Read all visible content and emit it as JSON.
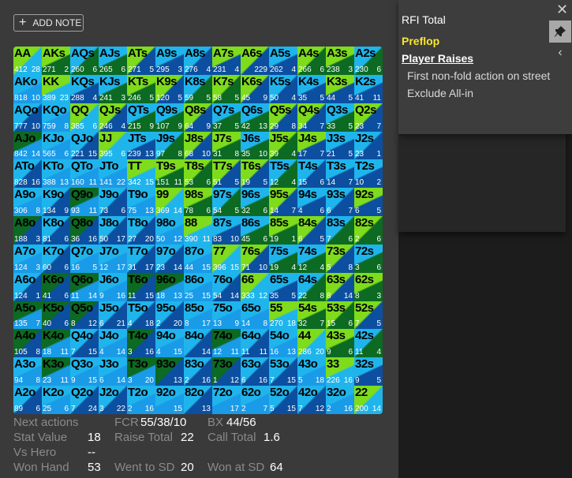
{
  "toolbar": {
    "add_note_label": "ADD NOTE"
  },
  "panel": {
    "title": "RFI Total",
    "preflop": "Preflop",
    "player_raises": "Player Raises",
    "option1": "First non-fold action on street",
    "option2": "Exclude All-in"
  },
  "colors": {
    "lime": "#7edc1c",
    "blue": "#1a9be8",
    "dark_green": "#0c6a22",
    "dark_blue": "#0c4fa0",
    "sky": "#1fb5ec"
  },
  "grid": [
    [
      [
        "AA",
        "412",
        "28"
      ],
      [
        "AKs",
        "271",
        "2"
      ],
      [
        "AQs",
        "260",
        "6"
      ],
      [
        "AJs",
        "265",
        "6"
      ],
      [
        "ATs",
        "271",
        "5"
      ],
      [
        "A9s",
        "295",
        "3"
      ],
      [
        "A8s",
        "276",
        "4"
      ],
      [
        "A7s",
        "231",
        "4"
      ],
      [
        "A6s",
        "",
        "229"
      ],
      [
        "A5s",
        "262",
        "4"
      ],
      [
        "A4s",
        "266",
        "6"
      ],
      [
        "A3s",
        "238",
        "3"
      ],
      [
        "A2s",
        "230",
        "6"
      ]
    ],
    [
      [
        "AKo",
        "818",
        "10"
      ],
      [
        "KK",
        "389",
        "23"
      ],
      [
        "KQs",
        "288",
        "4"
      ],
      [
        "KJs",
        "241",
        "3"
      ],
      [
        "KTs",
        "246",
        "5"
      ],
      [
        "K9s",
        "120",
        "5"
      ],
      [
        "K8s",
        "59",
        "5"
      ],
      [
        "K7s",
        "58",
        "5"
      ],
      [
        "K6s",
        "45",
        "9"
      ],
      [
        "K5s",
        "50",
        "4"
      ],
      [
        "K4s",
        "35",
        "5"
      ],
      [
        "K3s",
        "44",
        "5"
      ],
      [
        "K2s",
        "41",
        "11"
      ]
    ],
    [
      [
        "AQo",
        "777",
        "10"
      ],
      [
        "KQo",
        "759",
        "8"
      ],
      [
        "QQ",
        "385",
        "6"
      ],
      [
        "QJs",
        "246",
        "4"
      ],
      [
        "QTs",
        "215",
        "9"
      ],
      [
        "Q9s",
        "107",
        "9"
      ],
      [
        "Q8s",
        "64",
        "9"
      ],
      [
        "Q7s",
        "37",
        "5"
      ],
      [
        "Q6s",
        "42",
        "13"
      ],
      [
        "Q5s",
        "29",
        "8"
      ],
      [
        "Q4s",
        "34",
        "7"
      ],
      [
        "Q3s",
        "33",
        "5"
      ],
      [
        "Q2s",
        "23",
        "7"
      ]
    ],
    [
      [
        "AJo",
        "842",
        "14"
      ],
      [
        "KJo",
        "565",
        "6"
      ],
      [
        "QJo",
        "221",
        "15"
      ],
      [
        "JJ",
        "395",
        "6"
      ],
      [
        "JTs",
        "239",
        "13"
      ],
      [
        "J9s",
        "97",
        "8"
      ],
      [
        "J8s",
        "68",
        "10"
      ],
      [
        "J7s",
        "31",
        "8"
      ],
      [
        "J6s",
        "35",
        "10"
      ],
      [
        "J5s",
        "39",
        "4"
      ],
      [
        "J4s",
        "17",
        "7"
      ],
      [
        "J3s",
        "21",
        "5"
      ],
      [
        "J2s",
        "23",
        "1"
      ]
    ],
    [
      [
        "ATo",
        "828",
        "16"
      ],
      [
        "KTo",
        "388",
        "13"
      ],
      [
        "QTo",
        "160",
        "11"
      ],
      [
        "JTo",
        "141",
        "22"
      ],
      [
        "TT",
        "342",
        "15"
      ],
      [
        "T9s",
        "151",
        "11"
      ],
      [
        "T8s",
        "53",
        "6"
      ],
      [
        "T7s",
        "51",
        "5"
      ],
      [
        "T6s",
        "19",
        "5"
      ],
      [
        "T5s",
        "12",
        "4"
      ],
      [
        "T4s",
        "15",
        "6"
      ],
      [
        "T3s",
        "14",
        "7"
      ],
      [
        "T2s",
        "10",
        "2"
      ]
    ],
    [
      [
        "A9o",
        "306",
        "8"
      ],
      [
        "K9o",
        "134",
        "9"
      ],
      [
        "Q9o",
        "93",
        "11"
      ],
      [
        "J9o",
        "73",
        "6"
      ],
      [
        "T9o",
        "75",
        "13"
      ],
      [
        "99",
        "369",
        "14"
      ],
      [
        "98s",
        "78",
        "6"
      ],
      [
        "97s",
        "54",
        "5"
      ],
      [
        "96s",
        "32",
        "6"
      ],
      [
        "95s",
        "14",
        "7"
      ],
      [
        "94s",
        "4",
        "6"
      ],
      [
        "93s",
        "6",
        "7"
      ],
      [
        "92s",
        "6",
        "5"
      ]
    ],
    [
      [
        "A8o",
        "188",
        "3"
      ],
      [
        "K8o",
        "81",
        "6"
      ],
      [
        "Q8o",
        "36",
        "16"
      ],
      [
        "J8o",
        "50",
        "17"
      ],
      [
        "T8o",
        "27",
        "20"
      ],
      [
        "98o",
        "50",
        "12"
      ],
      [
        "88",
        "390",
        "11"
      ],
      [
        "87s",
        "83",
        "10"
      ],
      [
        "86s",
        "45",
        "6"
      ],
      [
        "85s",
        "19",
        "1"
      ],
      [
        "84s",
        "6",
        "5"
      ],
      [
        "83s",
        "7",
        "6"
      ],
      [
        "82s",
        "2",
        "6"
      ]
    ],
    [
      [
        "A7o",
        "124",
        "3"
      ],
      [
        "K7o",
        "60",
        "6"
      ],
      [
        "Q7o",
        "16",
        "5"
      ],
      [
        "J7o",
        "12",
        "17"
      ],
      [
        "T7o",
        "31",
        "17"
      ],
      [
        "97o",
        "23",
        "14"
      ],
      [
        "87o",
        "44",
        "15"
      ],
      [
        "77",
        "396",
        "15"
      ],
      [
        "76s",
        "71",
        "10"
      ],
      [
        "75s",
        "19",
        "4"
      ],
      [
        "74s",
        "12",
        "4"
      ],
      [
        "73s",
        "5",
        "8"
      ],
      [
        "72s",
        "3",
        "6"
      ]
    ],
    [
      [
        "A6o",
        "124",
        "1"
      ],
      [
        "K6o",
        "41",
        "6"
      ],
      [
        "Q6o",
        "11",
        "14"
      ],
      [
        "J6o",
        "9",
        "16"
      ],
      [
        "T6o",
        "11",
        "15"
      ],
      [
        "96o",
        "18",
        "13"
      ],
      [
        "86o",
        "25",
        "15"
      ],
      [
        "76o",
        "54",
        "14"
      ],
      [
        "66",
        "333",
        "12"
      ],
      [
        "65s",
        "35",
        "5"
      ],
      [
        "64s",
        "22",
        "8"
      ],
      [
        "63s",
        "8",
        "14"
      ],
      [
        "62s",
        "8",
        "3"
      ]
    ],
    [
      [
        "A5o",
        "135",
        "7"
      ],
      [
        "K5o",
        "40",
        "6"
      ],
      [
        "Q5o",
        "8",
        "12"
      ],
      [
        "J5o",
        "6",
        "21"
      ],
      [
        "T5o",
        "4",
        "18"
      ],
      [
        "95o",
        "2",
        "20"
      ],
      [
        "85o",
        "8",
        "17"
      ],
      [
        "75o",
        "13",
        "9"
      ],
      [
        "65o",
        "14",
        "8"
      ],
      [
        "55",
        "270",
        "18"
      ],
      [
        "54s",
        "32",
        "7"
      ],
      [
        "53s",
        "15",
        "6"
      ],
      [
        "52s",
        "7",
        "5"
      ]
    ],
    [
      [
        "A4o",
        "105",
        "8"
      ],
      [
        "K4o",
        "18",
        "11"
      ],
      [
        "Q4o",
        "7",
        "15"
      ],
      [
        "J4o",
        "4",
        "14"
      ],
      [
        "T4o",
        "3",
        "16"
      ],
      [
        "94o",
        "4",
        "15"
      ],
      [
        "84o",
        "",
        "14"
      ],
      [
        "74o",
        "12",
        "11"
      ],
      [
        "64o",
        "11",
        "11"
      ],
      [
        "54o",
        "16",
        "13"
      ],
      [
        "44",
        "286",
        "20"
      ],
      [
        "43s",
        "9",
        "6"
      ],
      [
        "42s",
        "11",
        "4"
      ]
    ],
    [
      [
        "A3o",
        "94",
        "8"
      ],
      [
        "K3o",
        "23",
        "11"
      ],
      [
        "Q3o",
        "9",
        "15"
      ],
      [
        "J3o",
        "6",
        "14"
      ],
      [
        "T3o",
        "3",
        "20"
      ],
      [
        "93o",
        "",
        "13"
      ],
      [
        "83o",
        "2",
        "16"
      ],
      [
        "73o",
        "1",
        "12"
      ],
      [
        "63o",
        "6",
        "16"
      ],
      [
        "53o",
        "7",
        "15"
      ],
      [
        "43o",
        "5",
        "18"
      ],
      [
        "33",
        "226",
        "16"
      ],
      [
        "32s",
        "9",
        "5"
      ]
    ],
    [
      [
        "A2o",
        "89",
        "6"
      ],
      [
        "K2o",
        "25",
        "6"
      ],
      [
        "Q2o",
        "7",
        "24"
      ],
      [
        "J2o",
        "3",
        "22"
      ],
      [
        "T2o",
        "2",
        "16"
      ],
      [
        "92o",
        "",
        "15"
      ],
      [
        "82o",
        "",
        "13"
      ],
      [
        "72o",
        "",
        "17"
      ],
      [
        "62o",
        "2",
        "7"
      ],
      [
        "52o",
        "5",
        "15"
      ],
      [
        "42o",
        "7",
        "12"
      ],
      [
        "32o",
        "2",
        "16"
      ],
      [
        "22",
        "200",
        "14"
      ]
    ]
  ],
  "stats": {
    "next_actions_label": "Next actions",
    "fcr_label": "FCR",
    "fcr_value": "55/38/10",
    "bx_label": "BX",
    "bx_value": "44/56",
    "stat_value_label": "Stat Value",
    "stat_value": "18",
    "raise_total_label": "Raise Total",
    "raise_total_value": "22",
    "call_total_label": "Call Total",
    "call_total_value": "1.6",
    "vs_hero_label": "Vs Hero",
    "vs_hero_value": "--",
    "won_hand_label": "Won Hand",
    "won_hand_value": "53",
    "went_sd_label": "Went to SD",
    "went_sd_value": "20",
    "won_sd_label": "Won at SD",
    "won_sd_value": "64"
  }
}
